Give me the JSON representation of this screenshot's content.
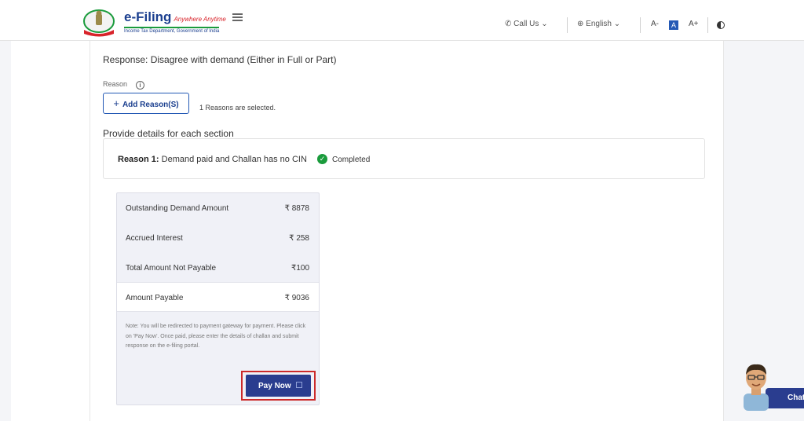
{
  "header": {
    "brand": "e-Filing",
    "brand_tagline": "Anywhere Anytime",
    "brand_sub": "Income Tax Department, Government of India",
    "call_us": "Call Us",
    "language": "English",
    "font_decrease": "A-",
    "font_normal": "A",
    "font_increase": "A+"
  },
  "form": {
    "response": "Response: Disagree with demand (Either in Full or Part)",
    "reason_label": "Reason",
    "info_icon": "i",
    "add_reason_button": "Add Reason(S)",
    "reasons_selected": "1 Reasons are selected.",
    "details_title": "Provide details for each section",
    "reason_item_prefix": "Reason 1:",
    "reason_item_text": "Demand paid and Challan has no CIN",
    "reason_status": "Completed"
  },
  "summary": {
    "rows": [
      {
        "label": "Outstanding Demand Amount",
        "value": "₹ 8878"
      },
      {
        "label": "Accrued Interest",
        "value": "₹ 258"
      },
      {
        "label": "Total Amount Not Payable",
        "value": "₹100"
      },
      {
        "label": "Amount Payable",
        "value": "₹ 9036"
      }
    ],
    "note": "Note: You will be redirected to payment gateway for payment. Please click on 'Pay Now'. Once paid, please enter the details of challan and submit response on the e-filing portal.",
    "pay_now_button": "Pay Now"
  },
  "chat": {
    "label": "Chat"
  },
  "colors": {
    "primary": "#2a3d8f",
    "success": "#1a9b3c",
    "highlight": "#cc2a2a"
  }
}
